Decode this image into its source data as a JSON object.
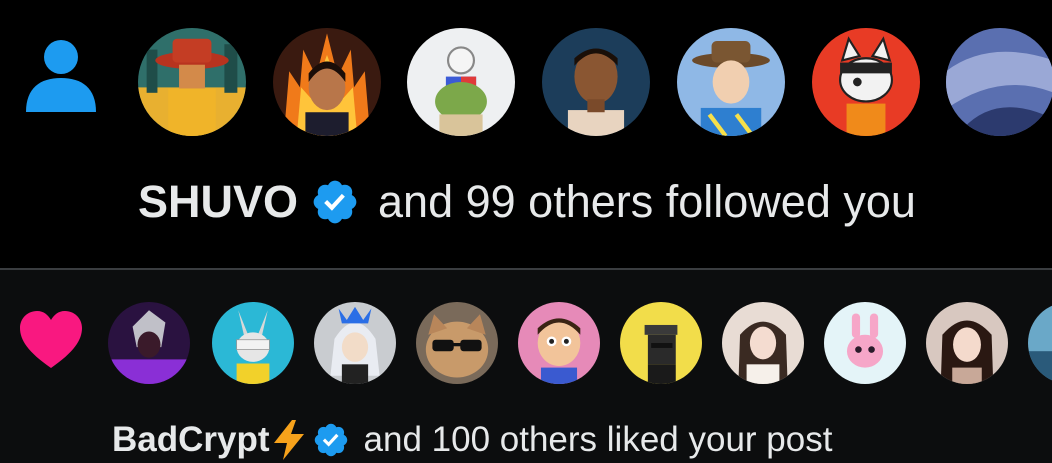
{
  "colors": {
    "accent": "#1d9bf0",
    "like": "#f91880",
    "text": "#e7e9ea",
    "background": "#000000"
  },
  "follow_notification": {
    "type_icon": "person-icon",
    "user_name": "SHUVO",
    "verified": true,
    "text": "and 99 others followed you"
  },
  "like_notification": {
    "type_icon": "heart-icon",
    "user_name": "BadCrypt",
    "name_emoji": "lightning-icon",
    "verified": true,
    "text": "and 100 others liked your post"
  }
}
